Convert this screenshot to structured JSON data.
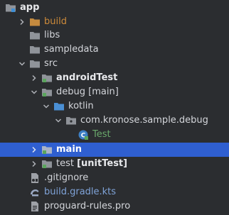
{
  "tree": {
    "items": [
      {
        "label": "app",
        "suffix": "",
        "icon": "module-folder-icon"
      },
      {
        "label": "build",
        "suffix": "",
        "icon": "folder-icon"
      },
      {
        "label": "libs",
        "suffix": "",
        "icon": "folder-icon"
      },
      {
        "label": "sampledata",
        "suffix": "",
        "icon": "folder-icon"
      },
      {
        "label": "src",
        "suffix": "",
        "icon": "folder-icon"
      },
      {
        "label": "androidTest",
        "suffix": "",
        "icon": "test-source-folder-icon"
      },
      {
        "label": "debug",
        "suffix": "[main]",
        "icon": "source-folder-icon"
      },
      {
        "label": "kotlin",
        "suffix": "",
        "icon": "source-root-folder-icon"
      },
      {
        "label": "com.kronose.sample.debug",
        "suffix": "",
        "icon": "package-icon"
      },
      {
        "label": "Test",
        "suffix": "",
        "icon": "kotlin-class-icon"
      },
      {
        "label": "main",
        "suffix": "",
        "icon": "source-folder-icon"
      },
      {
        "label": "test",
        "suffix": "[unitTest]",
        "icon": "test-source-folder-icon"
      },
      {
        "label": ".gitignore",
        "suffix": "",
        "icon": "gitignore-file-icon"
      },
      {
        "label": "build.gradle.kts",
        "suffix": "",
        "icon": "gradle-file-icon"
      },
      {
        "label": "proguard-rules.pro",
        "suffix": "",
        "icon": "text-file-icon"
      }
    ]
  },
  "colors": {
    "background": "#2b2d30",
    "selection": "#2f5fd0",
    "text": "#d4d6db",
    "excluded_folder": "#cc8a3a",
    "test_class": "#6aa86b",
    "gradle_file": "#7fa3d8",
    "folder_icon": "#8f9399"
  }
}
